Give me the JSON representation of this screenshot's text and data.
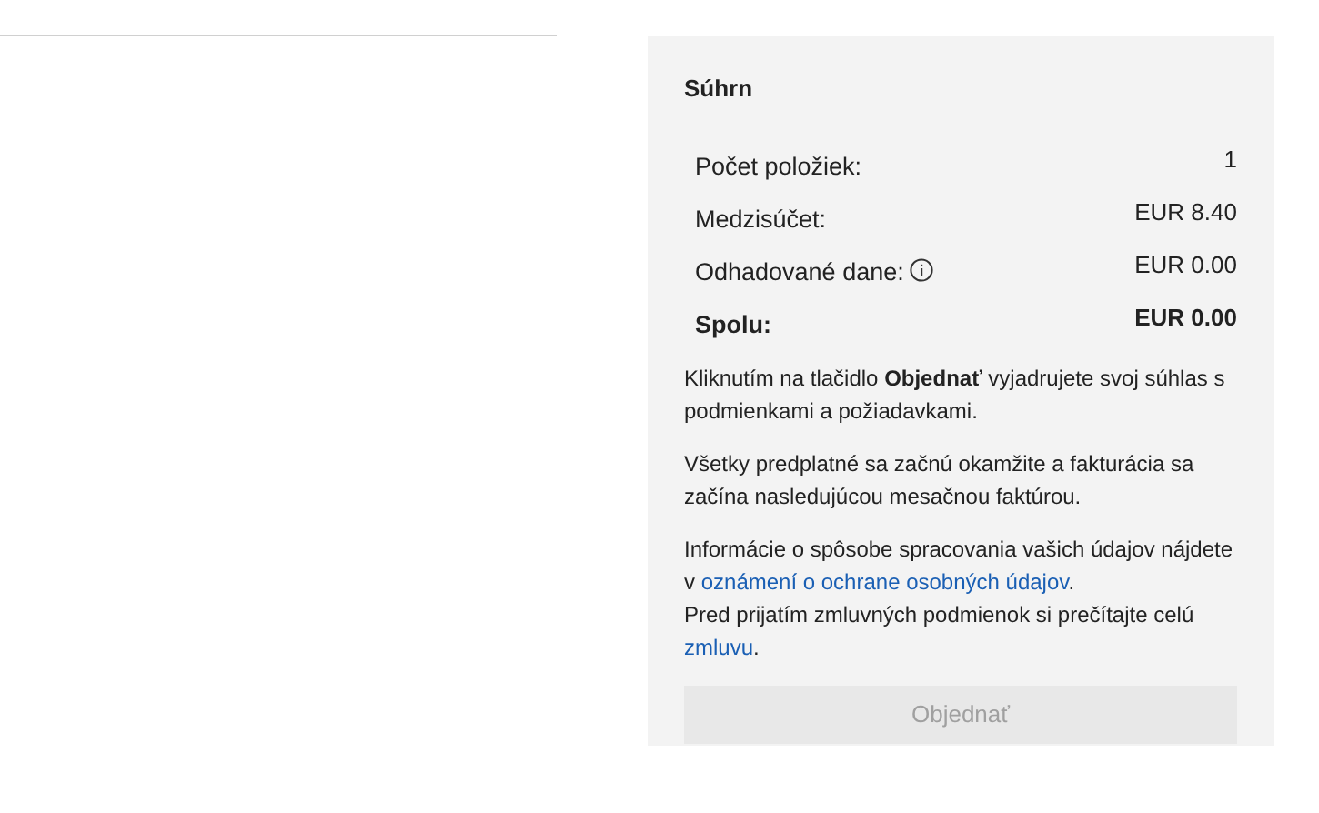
{
  "summary": {
    "title": "Súhrn",
    "rows": [
      {
        "kind": "plain",
        "label": "Počet položiek:",
        "value": "1"
      },
      {
        "kind": "plain",
        "label": "Medzisúčet:",
        "value": "EUR 8.40"
      },
      {
        "kind": "info",
        "label": "Odhadované dane:",
        "value": "EUR 0.00"
      },
      {
        "kind": "total",
        "label": "Spolu:",
        "value": "EUR 0.00"
      }
    ],
    "paragraphs": [
      [
        {
          "kind": "text",
          "text": "Kliknutím na tlačidlo **Objednať** vyjadrujete svoj súhlas s podmienkami a požiadavkami."
        }
      ],
      [
        {
          "kind": "text",
          "text": "Všetky predplatné sa začnú okamžite a fakturácia sa začína nasledujúcou mesačnou faktúrou."
        }
      ],
      [
        {
          "kind": "text",
          "text": "Informácie o spôsobe spracovania vašich údajov nájdete v "
        },
        {
          "kind": "link",
          "text": "oznámení o ochrane osobných údajov"
        },
        {
          "kind": "text",
          "text": "."
        }
      ],
      [
        {
          "kind": "text",
          "text": "Pred prijatím zmluvných podmienok si prečítajte celú "
        },
        {
          "kind": "link",
          "text": "zmluvu"
        },
        {
          "kind": "text",
          "text": "."
        }
      ]
    ],
    "order_button": {
      "label": "Objednať",
      "disabled": true
    }
  }
}
